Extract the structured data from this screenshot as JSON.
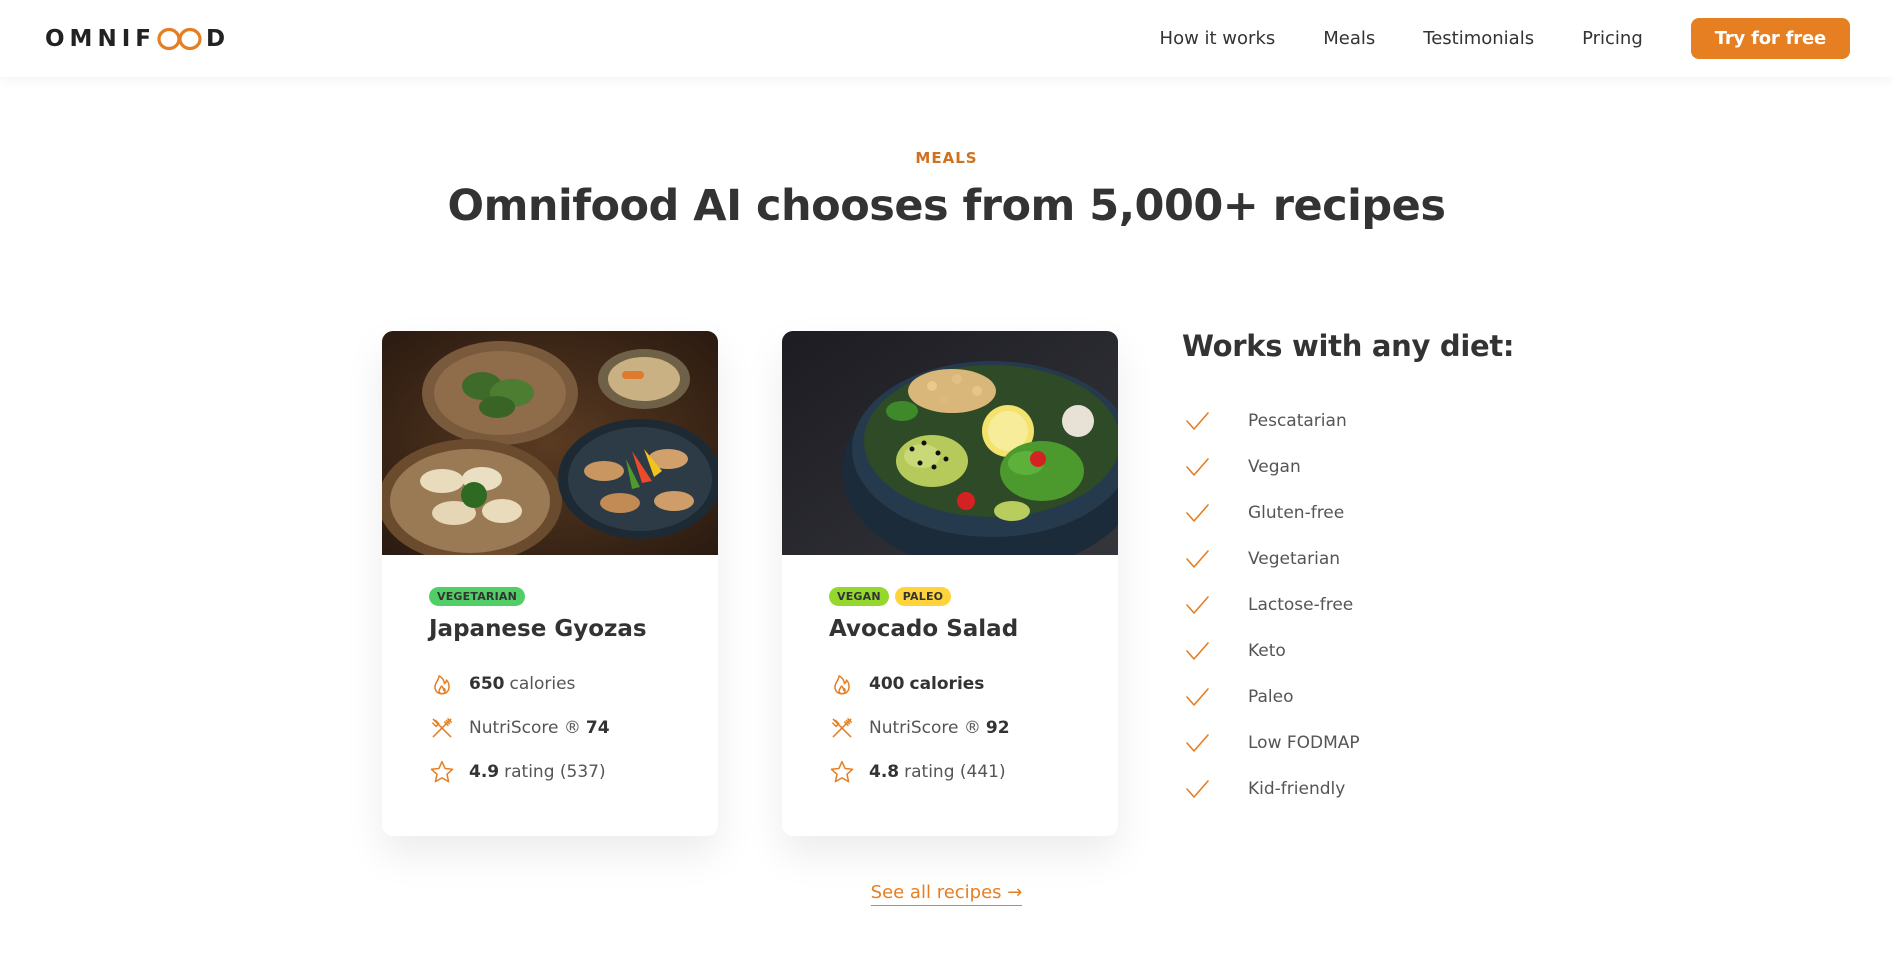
{
  "header": {
    "logo_text_left": "OMNIF",
    "logo_text_right": "D",
    "nav": [
      {
        "label": "How it works"
      },
      {
        "label": "Meals"
      },
      {
        "label": "Testimonials"
      },
      {
        "label": "Pricing"
      }
    ],
    "cta": "Try for free"
  },
  "section": {
    "subheading": "MEALS",
    "heading": "Omnifood AI chooses from 5,000+ recipes"
  },
  "meals": [
    {
      "tags": [
        "VEGETARIAN"
      ],
      "title": "Japanese Gyozas",
      "calories_value": "650",
      "calories_label": "calories",
      "nutri_label": "NutriScore ®",
      "nutri_value": "74",
      "rating_value": "4.9",
      "rating_label": "rating (537)"
    },
    {
      "tags": [
        "VEGAN",
        "PALEO"
      ],
      "title": "Avocado Salad",
      "calories_value": "400",
      "calories_label": "calories",
      "nutri_label": "NutriScore ®",
      "nutri_value": "92",
      "rating_value": "4.8",
      "rating_label": "rating (441)"
    }
  ],
  "diets": {
    "title": "Works with any diet:",
    "items": [
      "Pescatarian",
      "Vegan",
      "Gluten-free",
      "Vegetarian",
      "Lactose-free",
      "Keto",
      "Paleo",
      "Low FODMAP",
      "Kid-friendly"
    ]
  },
  "see_all": "See all recipes →",
  "colors": {
    "accent": "#e67e22",
    "accent_dark": "#cf711f",
    "tag_vegetarian": "#51cf66",
    "tag_vegan": "#94d82d",
    "tag_paleo": "#ffd43b"
  }
}
